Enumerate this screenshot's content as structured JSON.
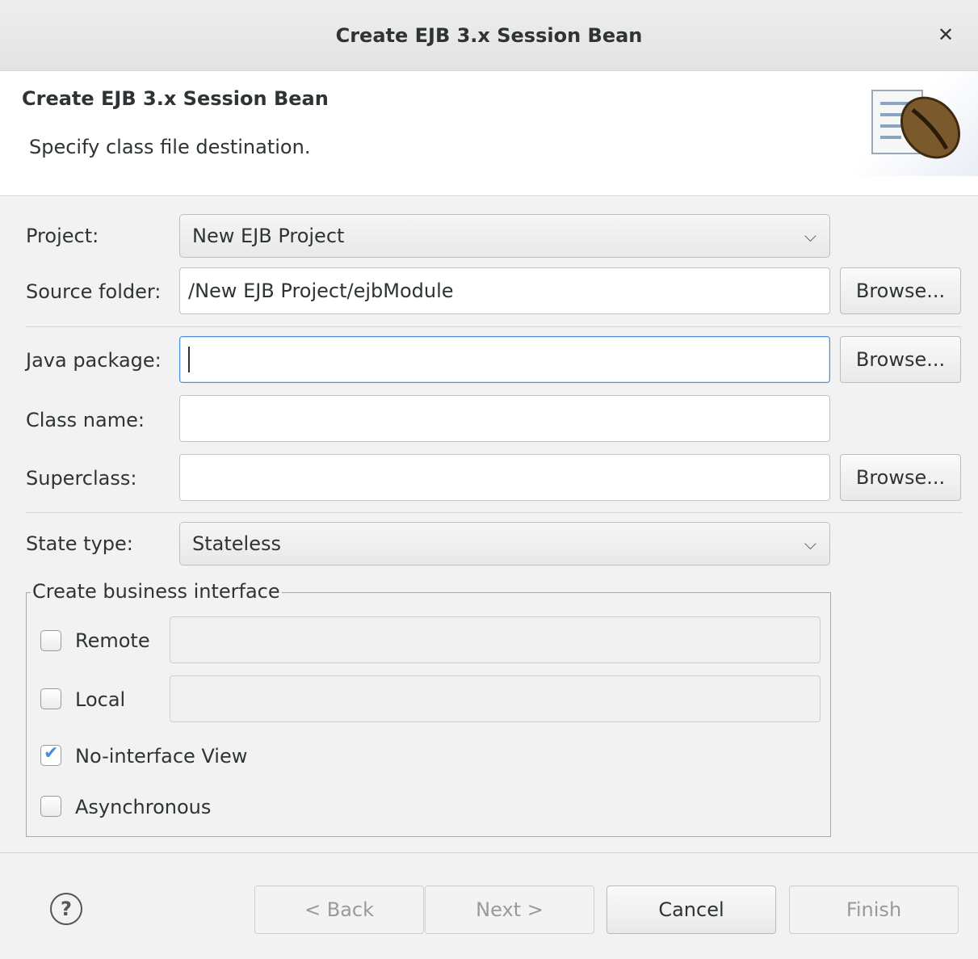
{
  "window": {
    "title": "Create EJB 3.x Session Bean"
  },
  "banner": {
    "heading": "Create EJB 3.x Session Bean",
    "description": "Specify class file destination."
  },
  "form": {
    "project": {
      "label": "Project:",
      "value": "New EJB Project"
    },
    "source_folder": {
      "label": "Source folder:",
      "value": "/New EJB Project/ejbModule",
      "browse": "Browse..."
    },
    "java_package": {
      "label": "Java package:",
      "value": "",
      "browse": "Browse..."
    },
    "class_name": {
      "label": "Class name:",
      "value": ""
    },
    "superclass": {
      "label": "Superclass:",
      "value": "",
      "browse": "Browse..."
    },
    "state_type": {
      "label": "State type:",
      "value": "Stateless"
    }
  },
  "business_interface": {
    "title": "Create business interface",
    "remote": {
      "label": "Remote",
      "checked": false,
      "value": ""
    },
    "local": {
      "label": "Local",
      "checked": false,
      "value": ""
    },
    "no_interface": {
      "label": "No-interface View",
      "checked": true
    },
    "asynchronous": {
      "label": "Asynchronous",
      "checked": false
    }
  },
  "footer": {
    "help": "?",
    "back": "< Back",
    "next": "Next >",
    "cancel": "Cancel",
    "finish": "Finish"
  },
  "icons": {
    "close": "close-icon",
    "chevron": "chevron-down-icon",
    "banner": "coffee-bean-icon",
    "help": "help-icon"
  }
}
